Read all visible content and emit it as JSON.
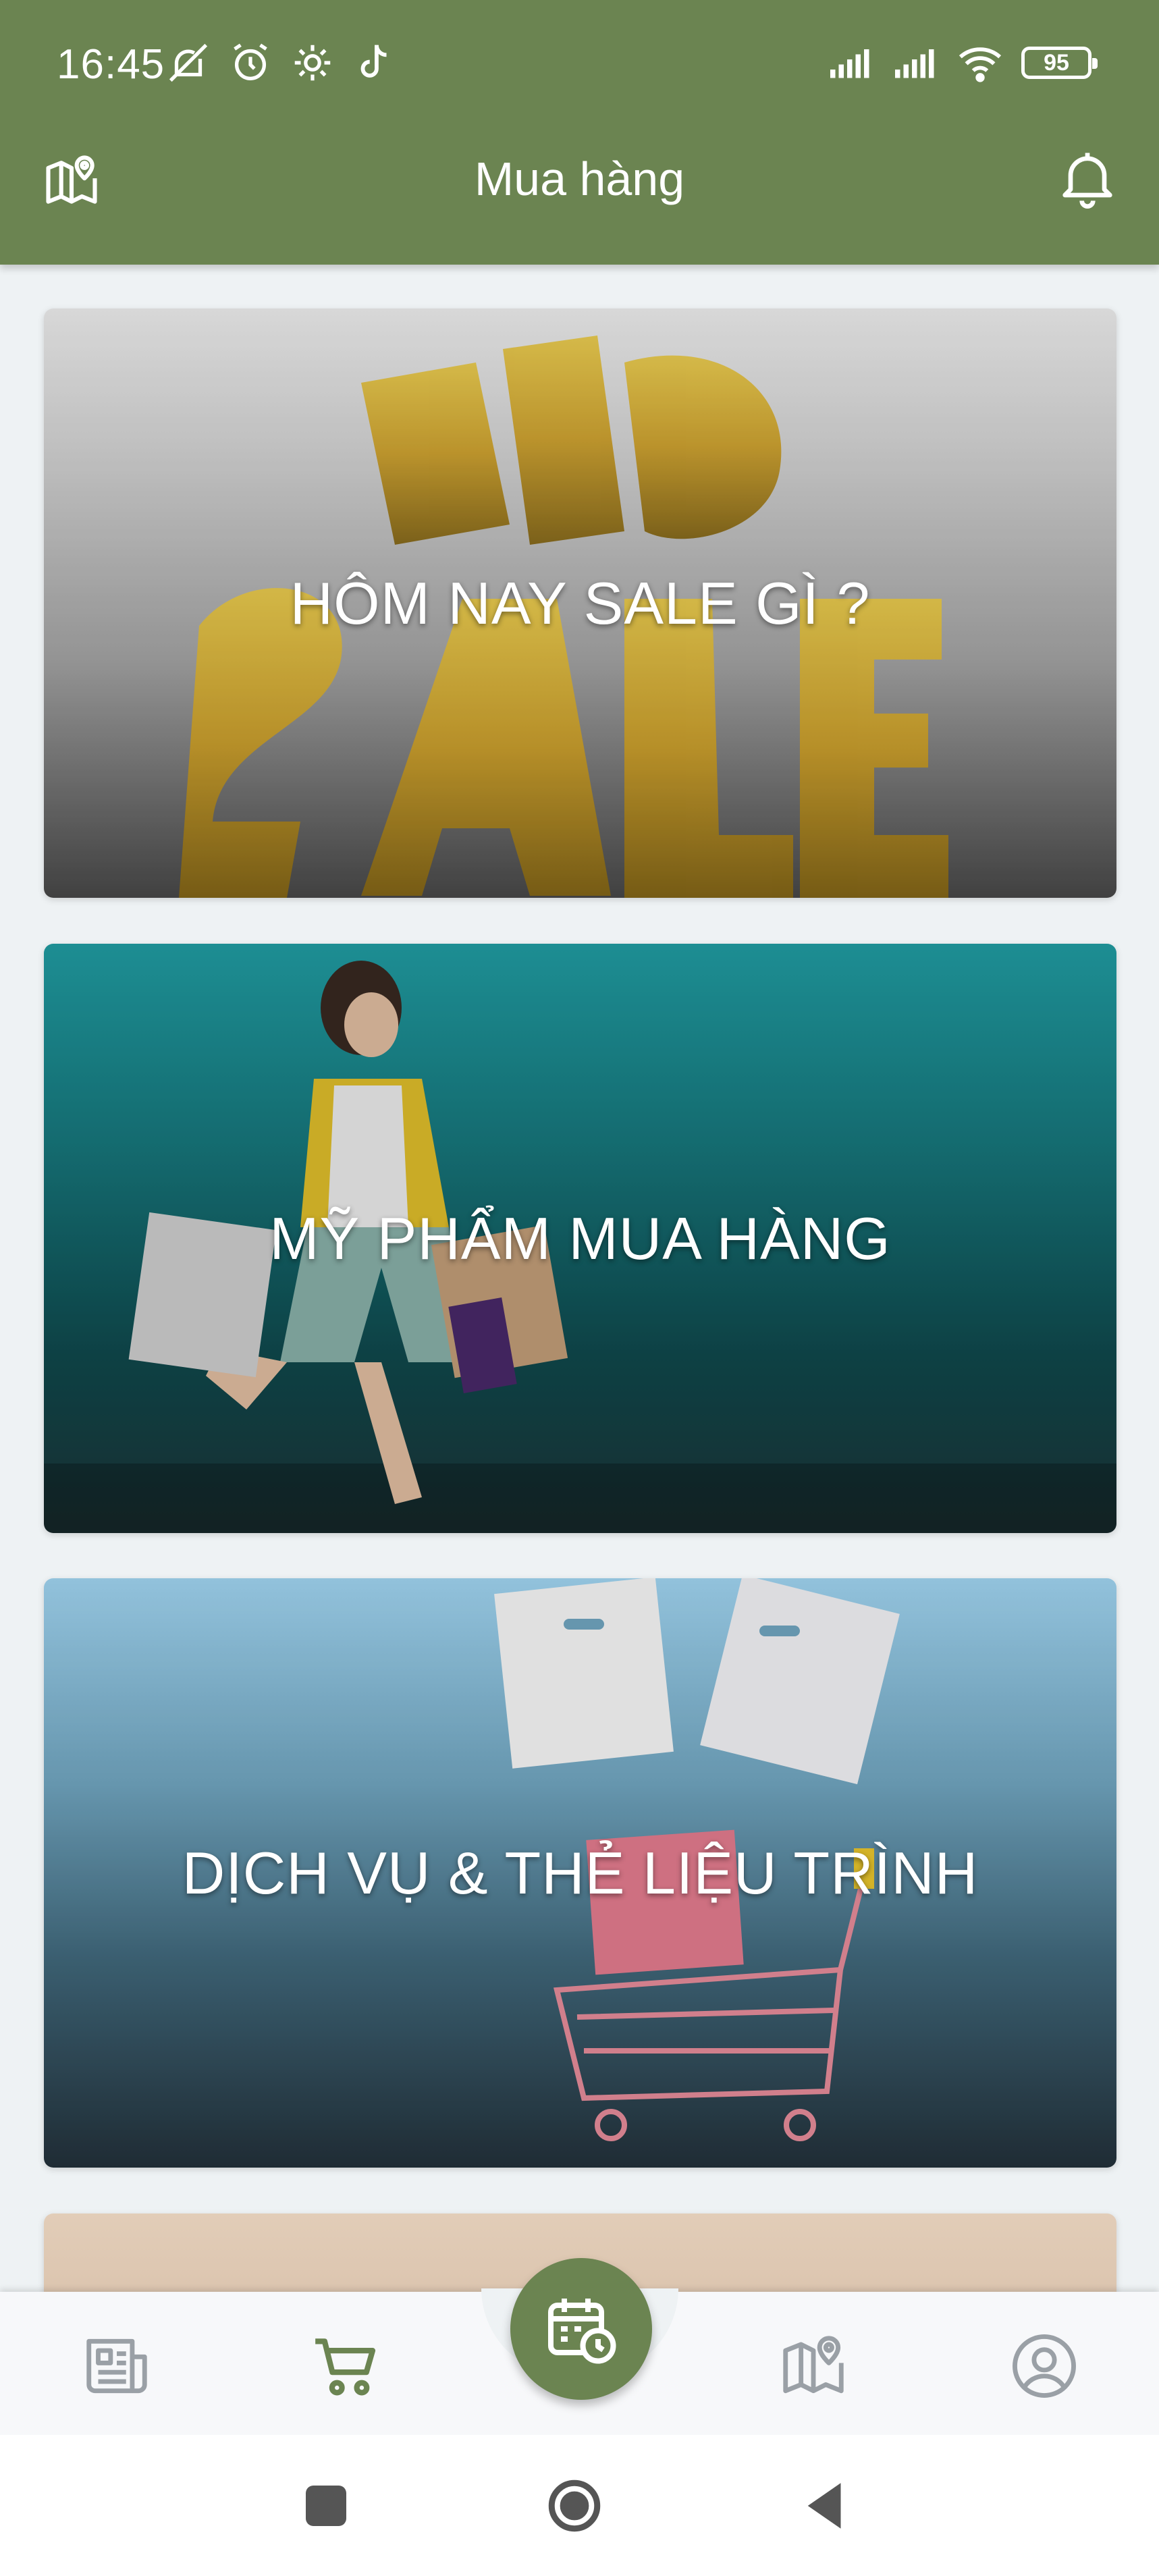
{
  "status_bar": {
    "time": "16:45",
    "battery": "95",
    "left_icons": [
      "mute-icon",
      "alarm-icon",
      "settings-icon",
      "tiktok-icon"
    ],
    "right_icons": [
      "signal-icon",
      "signal-icon",
      "wifi-icon",
      "battery-icon"
    ]
  },
  "toolbar": {
    "title": "Mua hàng",
    "left_icon": "map-pin-icon",
    "right_icon": "bell-icon"
  },
  "cards": [
    {
      "title": "HÔM NAY SALE GÌ ?",
      "image": "big-sale-image"
    },
    {
      "title": "MỸ PHẨM MUA HÀNG",
      "image": "shopping-woman-image"
    },
    {
      "title": "DỊCH VỤ & THẺ LIỆU TRÌNH",
      "image": "shopping-cart-bags-image"
    },
    {
      "title": "",
      "image": "beige-banner-image"
    }
  ],
  "bottom_nav": {
    "items": [
      {
        "icon": "news-icon"
      },
      {
        "icon": "cart-icon",
        "active": true
      },
      {
        "icon": "calendar-clock-icon",
        "center": true
      },
      {
        "icon": "map-icon"
      },
      {
        "icon": "profile-icon"
      }
    ],
    "active_color": "#6b8451",
    "inactive_color": "#9aa0a6"
  },
  "colors": {
    "primary": "#6b8451",
    "background": "#eef2f4"
  }
}
